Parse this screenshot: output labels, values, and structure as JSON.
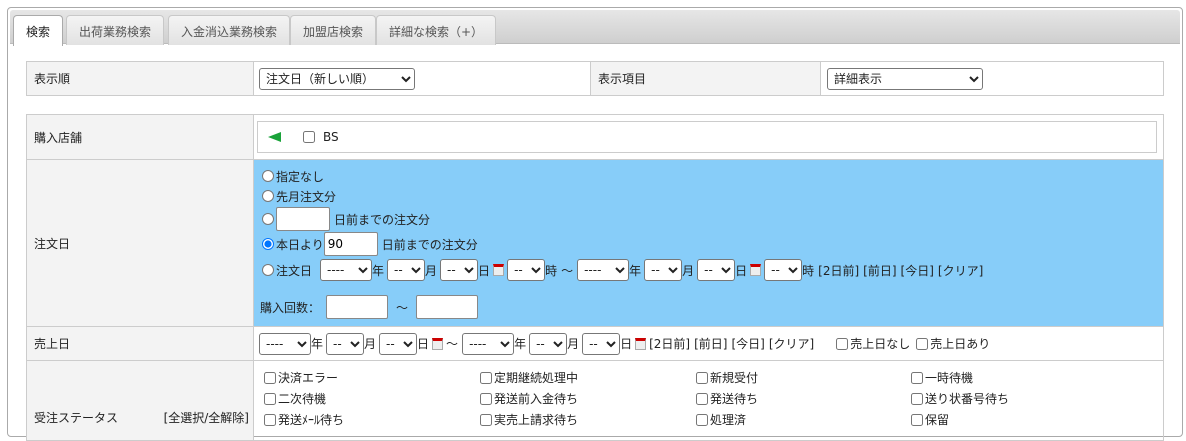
{
  "tabs": [
    "検索",
    "出荷業務検索",
    "入金消込業務検索",
    "加盟店検索",
    "詳細な検索（+）"
  ],
  "display": {
    "order_label": "表示順",
    "order_value": "注文日（新しい順）",
    "items_label": "表示項目",
    "items_value": "詳細表示"
  },
  "store": {
    "label": "購入店舗",
    "option": "BS",
    "flag_color": "#1aa33a"
  },
  "order_date": {
    "label": "注文日",
    "opt_none": "指定なし",
    "opt_last_month": "先月注文分",
    "opt_days_suffix": "日前までの注文分",
    "opt_today_prefix": "本日より",
    "today_days": "90",
    "opt_date": "注文日",
    "year_placeholder": "----",
    "sel_placeholder": "--",
    "year": "年",
    "month": "月",
    "day": "日",
    "hour": "時",
    "tilde": "～",
    "links": [
      "[2日前]",
      "[前日]",
      "[今日]",
      "[クリア]"
    ],
    "purchase_count_label": "購入回数："
  },
  "sales_date": {
    "label": "売上日",
    "none": "売上日なし",
    "exists": "売上日あり"
  },
  "status": {
    "label": "受注ステータス",
    "select_all": "[全選択/全解除]",
    "items": [
      "決済エラー",
      "定期継続処理中",
      "新規受付",
      "一時待機",
      "二次待機",
      "発送前入金待ち",
      "発送待ち",
      "送り状番号待ち",
      "発送ﾒｰﾙ待ち",
      "実売上請求待ち",
      "処理済",
      "保留"
    ]
  },
  "colors": {
    "highlight": "#87cdf9"
  }
}
